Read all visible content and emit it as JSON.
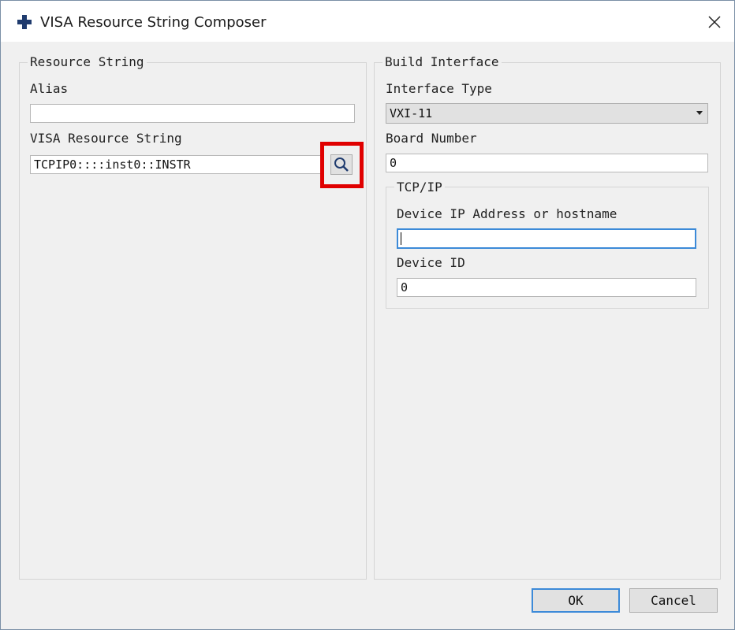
{
  "window": {
    "title": "VISA Resource String Composer"
  },
  "resource_string": {
    "group_label": "Resource String",
    "alias_label": "Alias",
    "alias_value": "",
    "visa_label": "VISA Resource String",
    "visa_value": "TCPIP0::::inst0::INSTR"
  },
  "build_interface": {
    "group_label": "Build Interface",
    "interface_type_label": "Interface Type",
    "interface_type_value": "VXI-11",
    "board_number_label": "Board Number",
    "board_number_value": "0",
    "tcpip": {
      "group_label": "TCP/IP",
      "ip_label": "Device IP Address or hostname",
      "ip_value": "",
      "device_id_label": "Device ID",
      "device_id_value": "0"
    }
  },
  "buttons": {
    "ok": "OK",
    "cancel": "Cancel"
  },
  "colors": {
    "highlight": "#e00000",
    "focus": "#3c8ad8",
    "title_icon": "#1f3b6e"
  },
  "icons": {
    "app": "plus-icon",
    "close": "close-icon",
    "search": "search-icon",
    "dropdown": "chevron-down-icon"
  }
}
